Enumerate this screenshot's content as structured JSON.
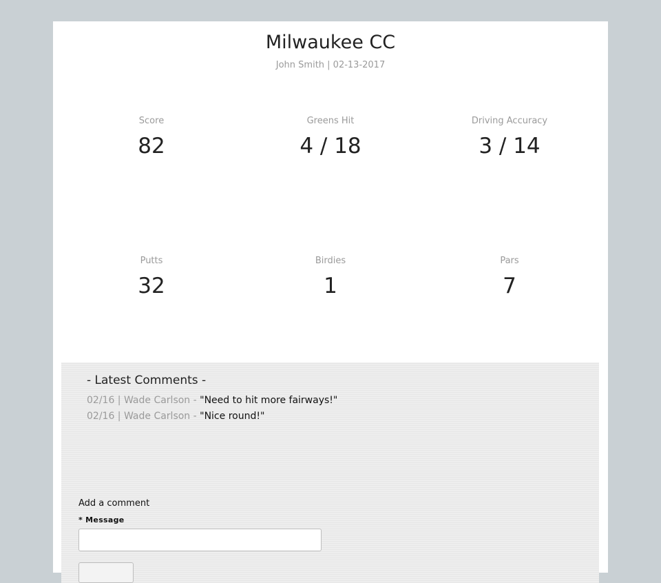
{
  "header": {
    "course": "Milwaukee CC",
    "player_date": "John Smith | 02-13-2017"
  },
  "stats": [
    {
      "label": "Score",
      "value": "82"
    },
    {
      "label": "Greens Hit",
      "value": "4 / 18"
    },
    {
      "label": "Driving Accuracy",
      "value": "3 / 14"
    },
    {
      "label": "Putts",
      "value": "32"
    },
    {
      "label": "Birdies",
      "value": "1"
    },
    {
      "label": "Pars",
      "value": "7"
    }
  ],
  "comments": {
    "heading": "- Latest Comments -",
    "items": [
      {
        "meta": "02/16 | Wade Carlson - ",
        "text": "\"Need to hit more fairways!\""
      },
      {
        "meta": "02/16 | Wade Carlson - ",
        "text": "\"Nice round!\""
      }
    ]
  },
  "comment_form": {
    "title": "Add a comment",
    "message_label": "* Message",
    "message_value": ""
  }
}
